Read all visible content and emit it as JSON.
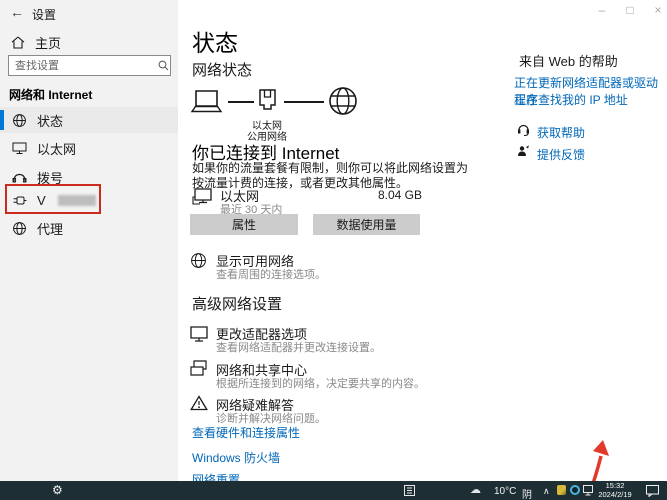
{
  "window": {
    "title": "设置",
    "controls": {
      "minimize": "–",
      "maximize": "□",
      "close": "×"
    }
  },
  "icons": {
    "back": "←",
    "gear": "⚙",
    "cloud": "☁",
    "chevron_up": "∧"
  },
  "sidebar": {
    "home_label": "主页",
    "search_placeholder": "查找设置",
    "section_title": "网络和 Internet",
    "items": [
      {
        "label": "状态",
        "icon": "globe",
        "selected": true
      },
      {
        "label": "以太网",
        "icon": "ethernet",
        "selected": false
      },
      {
        "label": "拨号",
        "icon": "dialup",
        "selected": false
      },
      {
        "label": "V",
        "icon": "vpn",
        "selected": false,
        "censored": true
      },
      {
        "label": "代理",
        "icon": "proxy",
        "selected": false
      }
    ]
  },
  "main": {
    "title": "状态",
    "network_status_heading": "网络状态",
    "diagram": {
      "label_line1": "以太网",
      "label_line2": "公用网络"
    },
    "connected": {
      "heading": "你已连接到 Internet",
      "description": "如果你的流量套餐有限制，则你可以将此网络设置为按流量计费的连接，或者更改其他属性。",
      "adapter_name": "以太网",
      "period": "最近 30 天内",
      "usage": "8.04 GB",
      "properties_button": "属性",
      "data_usage_button": "数据使用量"
    },
    "show_networks": {
      "title": "显示可用网络",
      "subtitle": "查看周围的连接选项。"
    },
    "advanced_heading": "高级网络设置",
    "advanced_items": [
      {
        "title": "更改适配器选项",
        "subtitle": "查看网络适配器并更改连接设置。"
      },
      {
        "title": "网络和共享中心",
        "subtitle": "根据所连接到的网络，决定要共享的内容。"
      },
      {
        "title": "网络疑难解答",
        "subtitle": "诊断并解决网络问题。"
      }
    ],
    "links": [
      "查看硬件和连接属性",
      "Windows 防火墙",
      "网络重置"
    ]
  },
  "help": {
    "heading": "来自 Web 的帮助",
    "links": [
      "正在更新网络适配器或驱动程序",
      "正在查找我的 IP 地址"
    ],
    "get_help_label": "获取帮助",
    "feedback_label": "提供反馈"
  },
  "taskbar": {
    "weather_temp": "10°C",
    "weather_cond": "阴",
    "time": "15:32",
    "date": "2024/2/19"
  },
  "colors": {
    "accent_link": "#0067b8",
    "sidebar_accent": "#0078d7",
    "taskbar_bg": "#1e2e35",
    "annotation_red": "#cb2a1d",
    "button_gray": "#cccccc"
  }
}
